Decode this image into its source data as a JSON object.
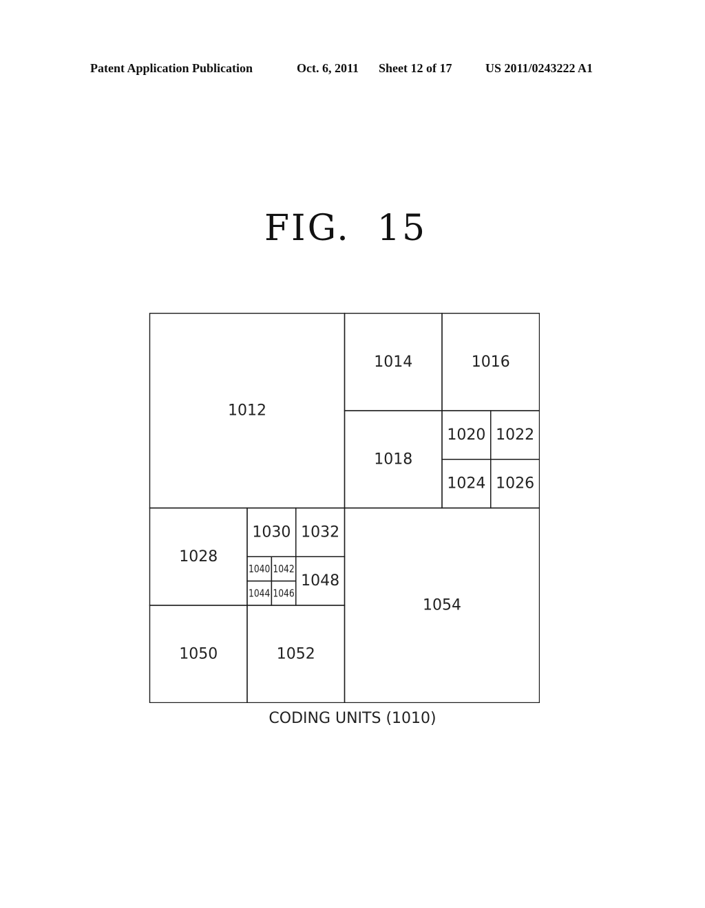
{
  "header": {
    "publication": "Patent Application Publication",
    "date": "Oct. 6, 2011",
    "sheet": "Sheet 12 of 17",
    "number": "US 2011/0243222 A1"
  },
  "figure": {
    "title": "FIG.  15",
    "caption": "CODING UNITS (1010)"
  },
  "diagram": {
    "grid_units": 8,
    "coding_units": [
      {
        "label": "1012",
        "col": 0,
        "row": 0,
        "size": 4
      },
      {
        "label": "1014",
        "col": 4,
        "row": 0,
        "size": 2
      },
      {
        "label": "1016",
        "col": 6,
        "row": 0,
        "size": 2
      },
      {
        "label": "1018",
        "col": 4,
        "row": 2,
        "size": 2
      },
      {
        "label": "1020",
        "col": 6,
        "row": 2,
        "size": 1
      },
      {
        "label": "1022",
        "col": 7,
        "row": 2,
        "size": 1
      },
      {
        "label": "1024",
        "col": 6,
        "row": 3,
        "size": 1
      },
      {
        "label": "1026",
        "col": 7,
        "row": 3,
        "size": 1
      },
      {
        "label": "1028",
        "col": 0,
        "row": 4,
        "size": 2
      },
      {
        "label": "1030",
        "col": 2,
        "row": 4,
        "size": 1
      },
      {
        "label": "1032",
        "col": 3,
        "row": 4,
        "size": 1
      },
      {
        "label": "1040",
        "col": 2,
        "row": 5,
        "size": 0.5
      },
      {
        "label": "1042",
        "col": 2.5,
        "row": 5,
        "size": 0.5
      },
      {
        "label": "1044",
        "col": 2,
        "row": 5.5,
        "size": 0.5
      },
      {
        "label": "1046",
        "col": 2.5,
        "row": 5.5,
        "size": 0.5
      },
      {
        "label": "1048",
        "col": 3,
        "row": 5,
        "size": 1
      },
      {
        "label": "1050",
        "col": 0,
        "row": 6,
        "size": 2
      },
      {
        "label": "1052",
        "col": 2,
        "row": 6,
        "size": 2
      },
      {
        "label": "1054",
        "col": 4,
        "row": 4,
        "size": 4
      }
    ]
  }
}
